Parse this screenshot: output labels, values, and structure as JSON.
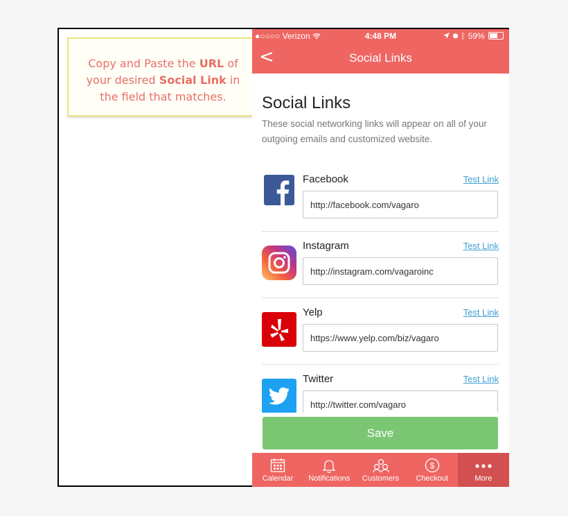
{
  "callout": {
    "line1_pre": "Copy and Paste the ",
    "line1_bold": "URL",
    "line1_post": " of",
    "line2_pre": "your desired ",
    "line2_bold": "Social Link",
    "line2_post": " in",
    "line3": "the field that matches."
  },
  "status": {
    "carrier": "●○○○○ Verizon",
    "time": "4:48 PM",
    "battery": "59%"
  },
  "nav": {
    "back": "<",
    "title": "Social Links"
  },
  "page": {
    "heading": "Social Links",
    "description": "These social networking links will appear on all of your outgoing emails and customized website."
  },
  "links": [
    {
      "name": "Facebook",
      "test_label": "Test Link",
      "value": "http://facebook.com/vagaro",
      "icon": "facebook-icon",
      "color": "#3b5998"
    },
    {
      "name": "Instagram",
      "test_label": "Test Link",
      "value": "http://instagram.com/vagaroinc",
      "icon": "instagram-icon",
      "color": "#c13584"
    },
    {
      "name": "Yelp",
      "test_label": "Test Link",
      "value": "https://www.yelp.com/biz/vagaro",
      "icon": "yelp-icon",
      "color": "#d32323"
    },
    {
      "name": "Twitter",
      "test_label": "Test Link",
      "value": "http://twitter.com/vagaro",
      "icon": "twitter-icon",
      "color": "#1da1f2"
    }
  ],
  "save_label": "Save",
  "tabs": [
    {
      "label": "Calendar",
      "icon": "calendar-icon"
    },
    {
      "label": "Notifications",
      "icon": "bell-icon"
    },
    {
      "label": "Customers",
      "icon": "customers-icon"
    },
    {
      "label": "Checkout",
      "icon": "dollar-icon"
    },
    {
      "label": "More",
      "icon": "more-icon",
      "active": true
    }
  ],
  "colors": {
    "brand": "#ee6562",
    "save": "#7ac673",
    "link": "#3f9ed4"
  }
}
